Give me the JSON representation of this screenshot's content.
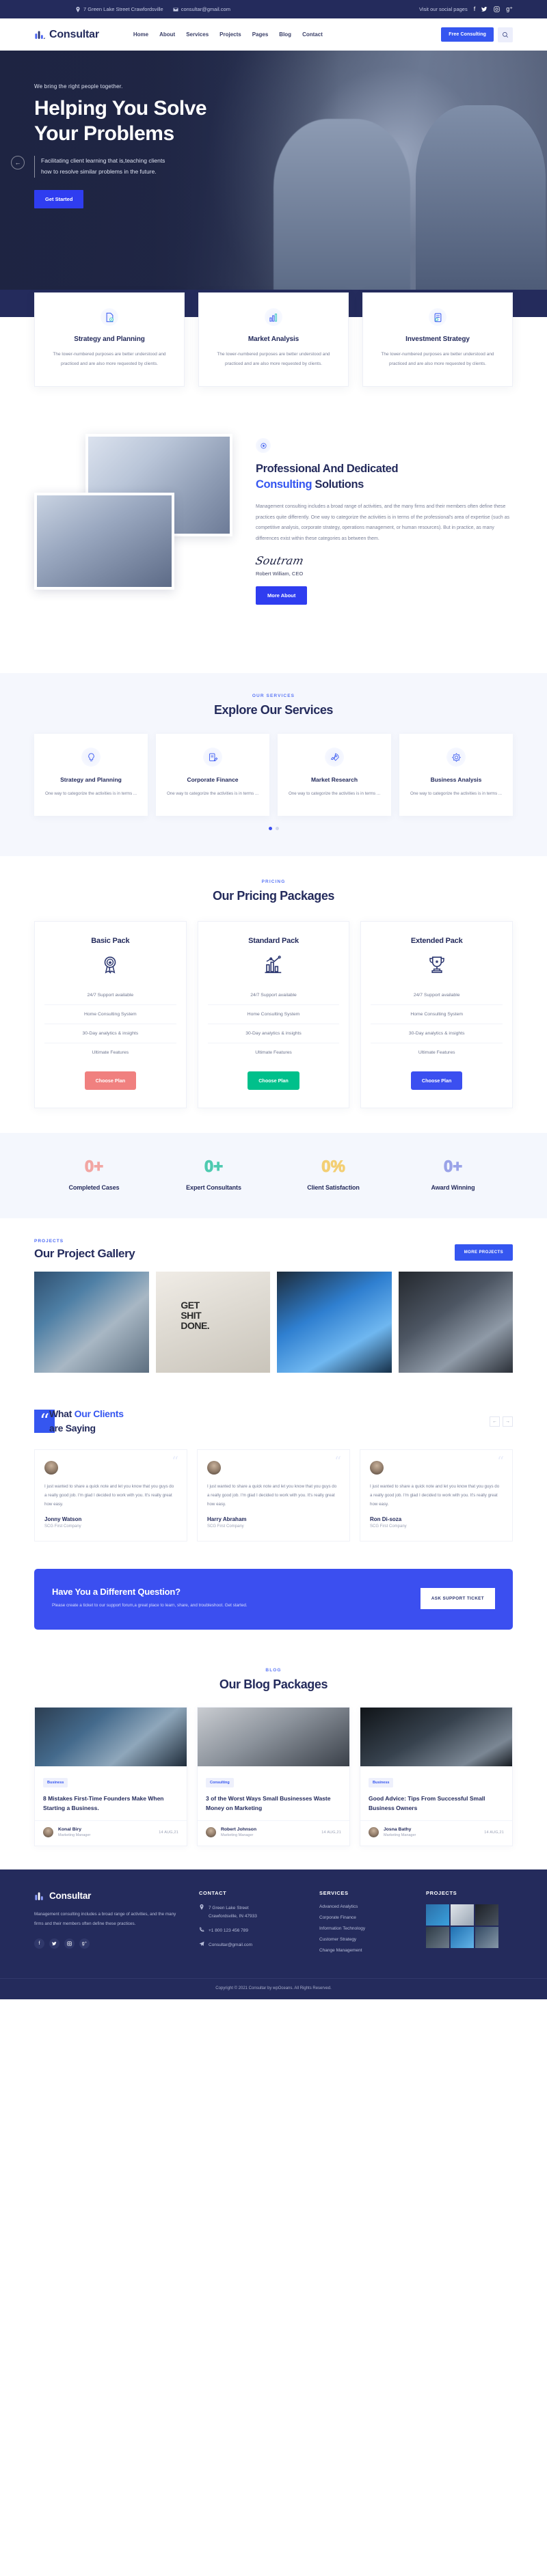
{
  "topbar": {
    "address": "7 Green Lake Street Crawfordsville",
    "email": "consultar@gmail.com",
    "social_label": "Visit our social pages",
    "social": [
      "f",
      "t",
      "ig",
      "g+"
    ]
  },
  "nav": {
    "brand": "Consultar",
    "links": [
      "Home",
      "About",
      "Services",
      "Projects",
      "Pages",
      "Blog",
      "Contact"
    ],
    "cta": "Free Consulting"
  },
  "hero": {
    "eyebrow": "We bring the right people together.",
    "title_line1": "Helping You Solve",
    "title_line2": "Your Problems",
    "desc_line1": "Facilitating client learning that is,teaching clients",
    "desc_line2": "how to resolve similar problems in the future.",
    "button": "Get Started"
  },
  "features": [
    {
      "title": "Strategy and Planning",
      "icon": "document-check-icon",
      "text": "The lower-numbered purposes are better understood and practiced and are also more requested by clients."
    },
    {
      "title": "Market Analysis",
      "icon": "bar-chart-icon",
      "text": "The lower-numbered purposes are better understood and practiced and are also more requested by clients."
    },
    {
      "title": "Investment Strategy",
      "icon": "clipboard-icon",
      "text": "The lower-numbered purposes are better understood and practiced and are also more requested by clients."
    }
  ],
  "about": {
    "title_1": "Professional And Dedicated",
    "title_hl": "Consulting",
    "title_2": " Solutions",
    "text": "Management consulting includes a broad range of activities, and the many firms and their members often define these practices quite differently. One way to categorize the activities is in terms of the professional's area of expertise (such as competitive analysis, corporate strategy, operations management, or human resources). But in practice, as many differences exist within these categories as between them.",
    "signature": "Soutram",
    "signer": "Robert William, CEO",
    "button": "More About"
  },
  "services": {
    "eyebrow": "OUR SERVICES",
    "title": "Explore Our Services",
    "cards": [
      {
        "title": "Strategy and Planning",
        "icon": "lightbulb-icon",
        "text": "One way to categorize the activities is in terms ..."
      },
      {
        "title": "Corporate Finance",
        "icon": "clipboard-pen-icon",
        "text": "One way to categorize the activities is in terms ..."
      },
      {
        "title": "Market Research",
        "icon": "rocket-icon",
        "text": "One way to categorize the activities is in terms ..."
      },
      {
        "title": "Business Analysis",
        "icon": "gear-chart-icon",
        "text": "One way to categorize the activities is in terms ..."
      }
    ]
  },
  "pricing": {
    "eyebrow": "PRICING",
    "title": "Our Pricing Packages",
    "features": [
      "24/7 Support available",
      "Home Consulting System",
      "30-Day analytics & insights",
      "Ultimate Features"
    ],
    "packs": [
      {
        "name": "Basic Pack",
        "icon": "award-ribbon-icon",
        "button": "Choose Plan",
        "color": "#f0807f"
      },
      {
        "name": "Standard Pack",
        "icon": "chart-bars-icon",
        "button": "Choose Plan",
        "color": "#00c08b"
      },
      {
        "name": "Extended Pack",
        "icon": "trophy-icon",
        "button": "Choose Plan",
        "color": "#3b4ff0"
      }
    ]
  },
  "counters": [
    {
      "value": "0+",
      "label": "Completed Cases",
      "color": "#f2a6a3"
    },
    {
      "value": "0+",
      "label": "Expert Consultants",
      "color": "#4ecab0"
    },
    {
      "value": "0%",
      "label": "Client Satisfaction",
      "color": "#f3cf74"
    },
    {
      "value": "0+",
      "label": "Award Winning",
      "color": "#9aa3e8"
    }
  ],
  "projects": {
    "eyebrow": "PROJECTS",
    "title": "Our Project Gallery",
    "button": "MORE PROJECTS",
    "images": [
      "handshake-meeting",
      "get-shit-done-desk",
      "skyscraper-handshake",
      "headset-consultant"
    ],
    "poster_text": "GET\nSHIT\nDONE."
  },
  "testimonials": {
    "title_1": "What ",
    "title_hl": "Our Clients",
    "title_2": "are Saying",
    "quote_mark": "“",
    "prev": "←",
    "next": "→",
    "items": [
      {
        "text": "I just wanted to share a quick note and let you know that you guys do a really good job. I'm glad I decided to work with you. It's really great how easy.",
        "name": "Jonny Watson",
        "company": "SCG First Company"
      },
      {
        "text": "I just wanted to share a quick note and let you know that you guys do a really good job. I'm glad I decided to work with you. It's really great how easy.",
        "name": "Harry Abraham",
        "company": "SCG First Company"
      },
      {
        "text": "I just wanted to share a quick note and let you know that you guys do a really good job. I'm glad I decided to work with you. It's really great how easy.",
        "name": "Ron Di-soza",
        "company": "SCG First Company"
      }
    ]
  },
  "cta": {
    "title": "Have You a Different Question?",
    "text": "Please create a ticket to our support forum,a great place to learn, share, and troubleshoot. Get started.",
    "button": "ASK SUPPORT TICKET"
  },
  "blog": {
    "eyebrow": "BLOG",
    "title": "Our Blog Packages",
    "posts": [
      {
        "tag": "Business",
        "title": "8 Mistakes First-Time Founders Make When Starting a Business.",
        "author": "Konal Biry",
        "role": "Marketing Manager",
        "date": "14 AUG,21"
      },
      {
        "tag": "Consulting",
        "title": "3 of the Worst Ways Small Businesses Waste Money on Marketing",
        "author": "Robert Johnson",
        "role": "Marketing Manager",
        "date": "14 AUG,21"
      },
      {
        "tag": "Business",
        "title": "Good Advice: Tips From Successful Small Business Owners",
        "author": "Josna Bathy",
        "role": "Marketing Manager",
        "date": "14 AUG,21"
      }
    ]
  },
  "footer": {
    "brand": "Consultar",
    "about": "Management consulting includes a broad range of activities, and the many firms and their members often define these practices.",
    "social": [
      "f",
      "t",
      "ig",
      "g+"
    ],
    "contact_head": "CONTACT",
    "address_line1": "7 Green Lake Street",
    "address_line2": "Crawfordsville, IN 47933",
    "phone": "+1 800 123 456 789",
    "email": "Consultar@gmail.com",
    "services_head": "SERVICES",
    "services": [
      "Advanced Analytics",
      "Corporate Finance",
      "Information Technology",
      "Customer Strategy",
      "Change Management"
    ],
    "projects_head": "PROJECTS",
    "copyright": "Copyright © 2021 Consultar by wpOceans. All Rights Reserved."
  },
  "colors": {
    "navy": "#242b5c",
    "accent": "#3556f0",
    "muted": "#7b8199"
  }
}
